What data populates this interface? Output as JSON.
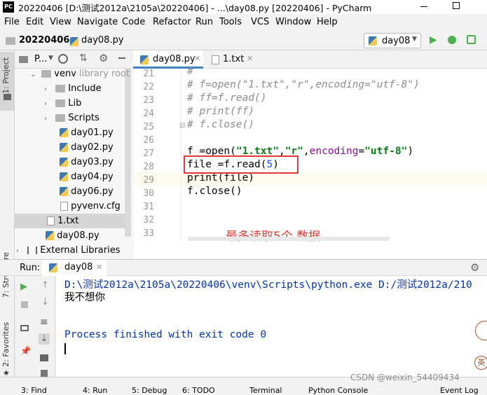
{
  "title": "20220406 [D:\\测试2012a\\2105a\\20220406] - ...\\day08.py [20220406] - PyCharm",
  "title_icon": "PC",
  "menu": [
    "File",
    "Edit",
    "View",
    "Navigate",
    "Code",
    "Refactor",
    "Run",
    "Tools",
    "VCS",
    "Window",
    "Help"
  ],
  "nav": {
    "project": "20220406",
    "file": "day08.py",
    "run_config": "day08"
  },
  "project_panel": {
    "header": "P...",
    "vtab_project": "1: Project",
    "vtab_structure": "7: Structure",
    "vtab_favorites": "2: Favorites"
  },
  "tree": {
    "venv": "venv",
    "venv_note": "library root",
    "include": "Include",
    "lib": "Lib",
    "scripts": "Scripts",
    "files": [
      "day01.py",
      "day02.py",
      "day03.py",
      "day04.py",
      "day06.py",
      "pyvenv.cfg"
    ],
    "txt": "1.txt",
    "day08": "day08.py",
    "external": "External Libraries"
  },
  "editor_tabs": [
    "day08.py",
    "1.txt"
  ],
  "line_numbers": [
    "21",
    "22",
    "23",
    "24",
    "25",
    "26",
    "27",
    "28",
    "29",
    "30",
    "31",
    "32",
    "33"
  ],
  "code": {
    "l21": "#",
    "l22": "# f=open(\"1.txt\",\"r\",encoding=\"utf-8\")",
    "l23": "# ff=f.read()",
    "l24": "# print(ff)",
    "l25": "# f.close()",
    "l27a": "f =open(",
    "l27s1": "\"1.txt\"",
    "l27c1": ",",
    "l27s2": "\"r\"",
    "l27c2": ",",
    "l27k": "encoding",
    "l27eq": "=",
    "l27s3": "\"utf-8\"",
    "l27e": ")",
    "l28a": "file =f.read(",
    "l28n": "5",
    "l28e": ")",
    "l29": "print(file)",
    "l30": "f.close()"
  },
  "annotation": "最多读取5个 数据",
  "run": {
    "label": "Run:",
    "tab": "day08",
    "line1": "D:\\测试2012a\\2105a\\20220406\\venv\\Scripts\\python.exe D:/测试2012a/210",
    "line2": "我不想你",
    "line3": "Process finished with exit code 0"
  },
  "bottom": [
    "3: Find",
    "4: Run",
    "5: Debug",
    "6: TODO",
    "Terminal",
    "Python Console",
    "Event Log"
  ],
  "watermark": "CSDN @weixin_54409434",
  "colors": {
    "accent_red": "#e53935",
    "console_blue": "#0033b3",
    "run_green": "#4caf50"
  }
}
